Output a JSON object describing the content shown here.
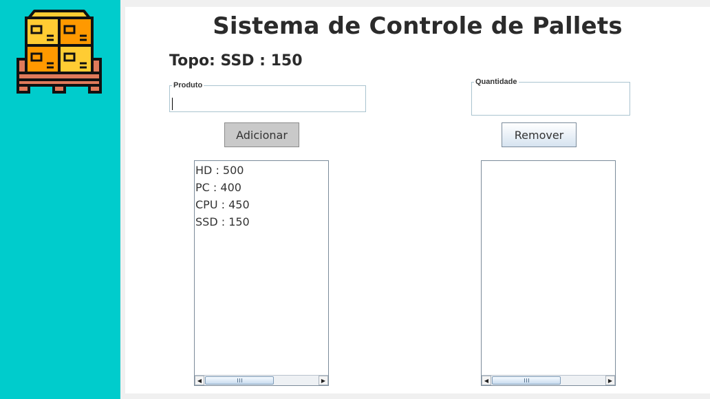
{
  "app": {
    "title": "Sistema de Controle de Pallets",
    "topo_label": "Topo: SSD : 150"
  },
  "sidebar": {
    "logo_icon": "pallet-boxes-icon",
    "background_color": "#00cccc"
  },
  "form": {
    "produto": {
      "legend": "Produto",
      "value": ""
    },
    "quantidade": {
      "legend": "Quantidade",
      "value": ""
    }
  },
  "buttons": {
    "adicionar": "Adicionar",
    "remover": "Remover"
  },
  "lists": {
    "left": [
      "HD : 500",
      "PC : 400",
      "CPU : 450",
      "SSD : 150"
    ],
    "right": []
  },
  "colors": {
    "accent": "#00cccc",
    "box_orange": "#ff9900",
    "box_yellow": "#ffcc33",
    "pallet": "#e07a5a"
  }
}
